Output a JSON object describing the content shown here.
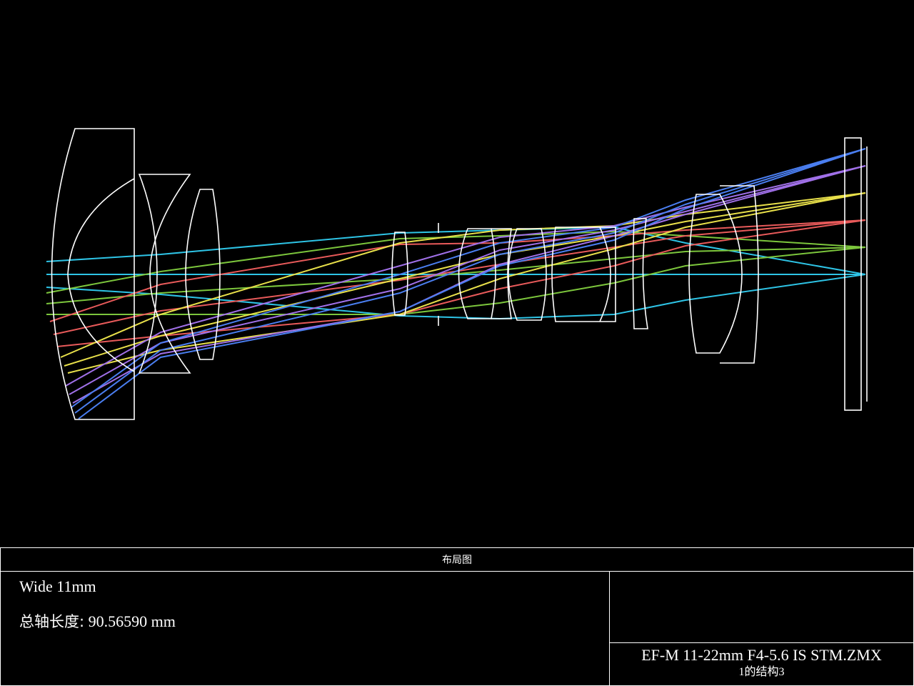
{
  "window_title": "布局图",
  "notes": {
    "line1": "Wide 11mm",
    "axial_length_label": "总轴长度:",
    "axial_length_value": "90.56590 mm"
  },
  "file": {
    "name": "EF-M 11-22mm F4-5.6 IS STM.ZMX",
    "config_prefix": "1",
    "config_label": "的结构",
    "config_number": "3"
  },
  "colors": {
    "background": "#000000",
    "lens_outline": "#ffffff",
    "field_colors": [
      "#2ec4e6",
      "#7cc63c",
      "#e85a5a",
      "#e8e04a",
      "#a070e8",
      "#4a7ef0"
    ]
  }
}
